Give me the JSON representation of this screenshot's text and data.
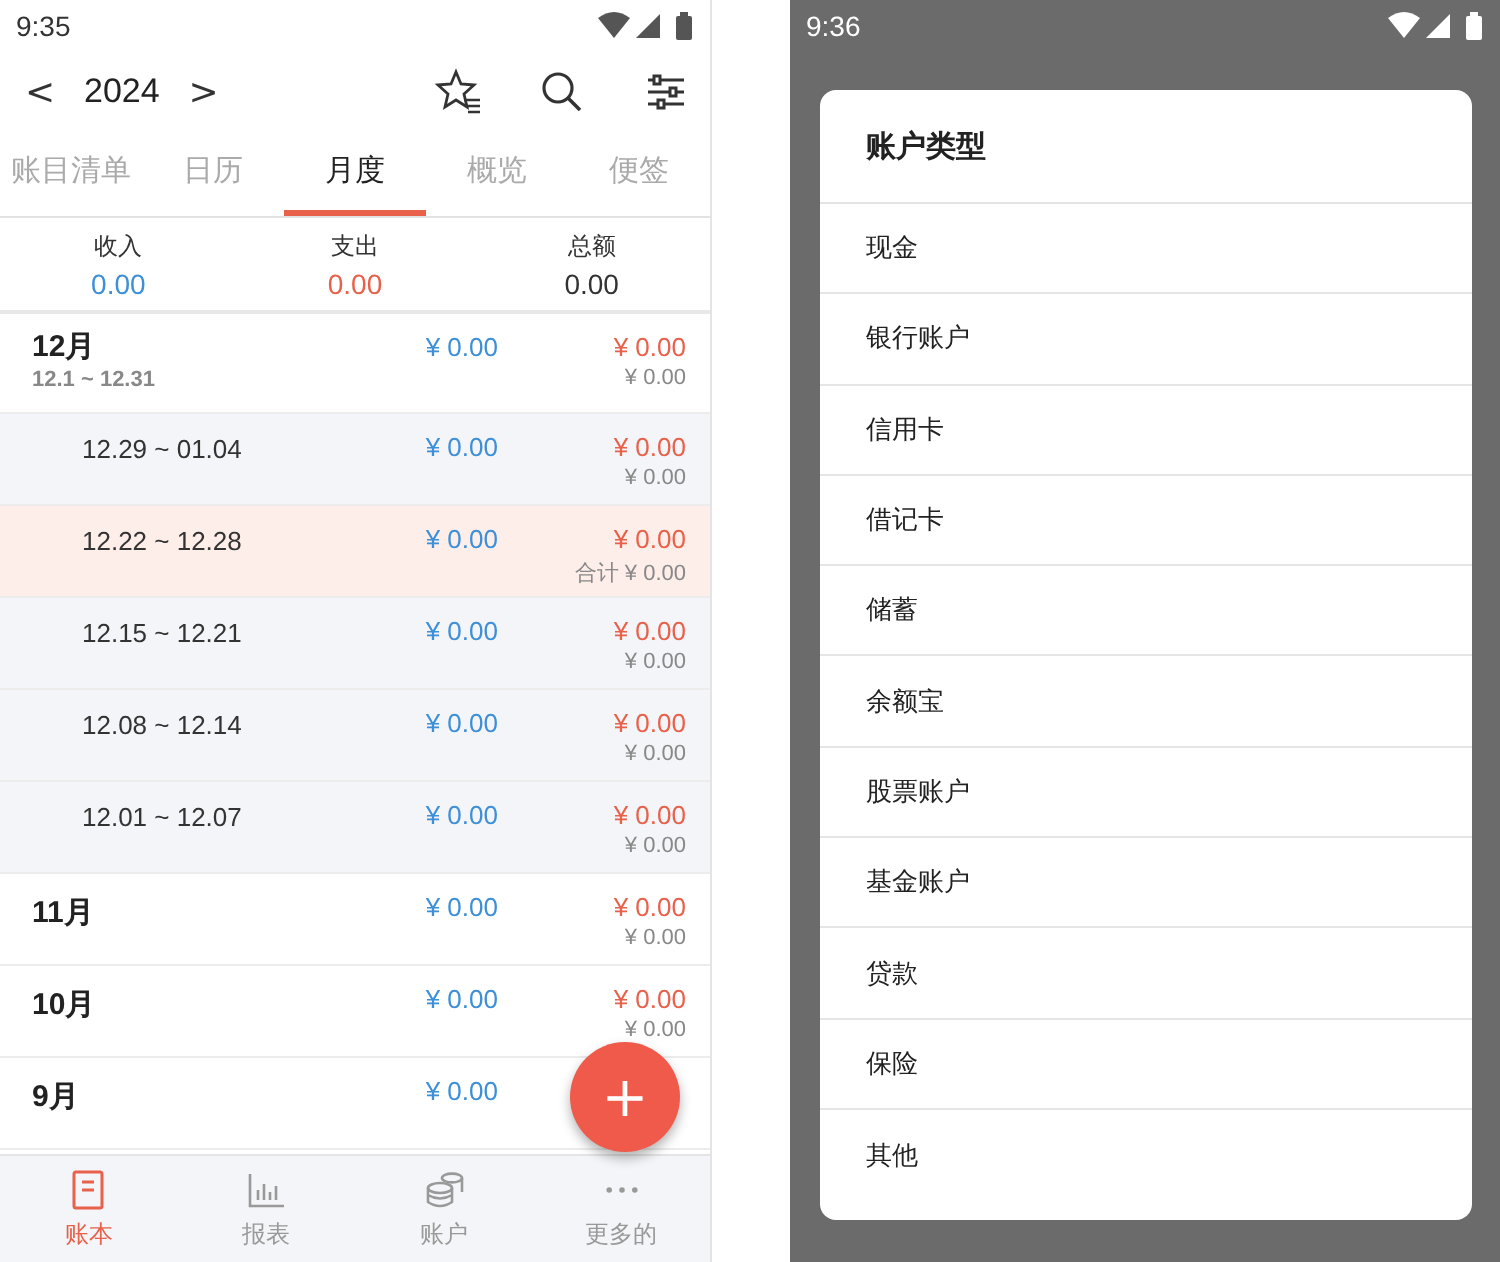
{
  "left_screen": {
    "status_bar": {
      "time": "9:35"
    },
    "toolbar": {
      "prev": "<",
      "year": "2024",
      "next": ">"
    },
    "tabs": [
      {
        "label": "账目清单",
        "selected": false
      },
      {
        "label": "日历",
        "selected": false
      },
      {
        "label": "月度",
        "selected": true
      },
      {
        "label": "概览",
        "selected": false
      },
      {
        "label": "便签",
        "selected": false
      }
    ],
    "summary": [
      {
        "label": "收入",
        "value": "0.00",
        "kind": "income"
      },
      {
        "label": "支出",
        "value": "0.00",
        "kind": "expense"
      },
      {
        "label": "总额",
        "value": "0.00",
        "kind": "total"
      }
    ],
    "months": [
      {
        "label": "12月",
        "range": "12.1 ~ 12.31",
        "income": "¥ 0.00",
        "expense": "¥ 0.00",
        "total": "¥ 0.00",
        "children": [
          {
            "range": "12.29 ~ 01.04",
            "income": "¥ 0.00",
            "expense": "¥ 0.00",
            "total": "¥ 0.00",
            "selected": false
          },
          {
            "range": "12.22 ~ 12.28",
            "income": "¥ 0.00",
            "expense": "¥ 0.00",
            "total": "合计 ¥ 0.00",
            "selected": true
          },
          {
            "range": "12.15 ~ 12.21",
            "income": "¥ 0.00",
            "expense": "¥ 0.00",
            "total": "¥ 0.00",
            "selected": false
          },
          {
            "range": "12.08 ~ 12.14",
            "income": "¥ 0.00",
            "expense": "¥ 0.00",
            "total": "¥ 0.00",
            "selected": false
          },
          {
            "range": "12.01 ~ 12.07",
            "income": "¥ 0.00",
            "expense": "¥ 0.00",
            "total": "¥ 0.00",
            "selected": false
          }
        ]
      },
      {
        "label": "11月",
        "income": "¥ 0.00",
        "expense": "¥ 0.00",
        "total": "¥ 0.00"
      },
      {
        "label": "10月",
        "income": "¥ 0.00",
        "expense": "¥ 0.00",
        "total": "¥ 0.00"
      },
      {
        "label": "9月",
        "income": "¥ 0.00"
      }
    ],
    "fab": "+",
    "bottom_nav": [
      {
        "label": "账本",
        "selected": true
      },
      {
        "label": "报表",
        "selected": false
      },
      {
        "label": "账户",
        "selected": false
      },
      {
        "label": "更多的",
        "selected": false
      }
    ]
  },
  "right_screen": {
    "status_bar": {
      "time": "9:36"
    },
    "dialog": {
      "title": "账户类型",
      "options": [
        "现金",
        "银行账户",
        "信用卡",
        "借记卡",
        "储蓄",
        "余额宝",
        "股票账户",
        "基金账户",
        "贷款",
        "保险",
        "其他"
      ]
    }
  }
}
